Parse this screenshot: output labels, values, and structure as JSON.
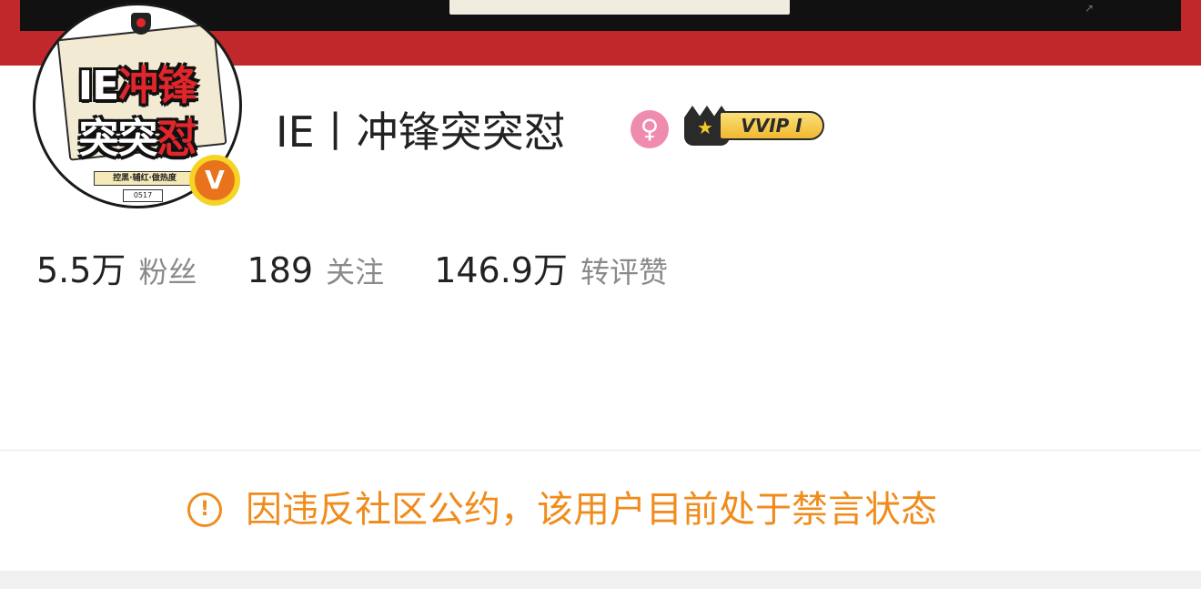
{
  "profile": {
    "avatar": {
      "line1a": "IE",
      "line1b": "冲锋",
      "line2a": "突突",
      "line2b": "怼",
      "tagline": "控黑·辅红·做热度",
      "code": "0517"
    },
    "verified_mark": "V",
    "username": "IE丨冲锋突突怼",
    "gender_icon": "female-icon",
    "vip_badge": "VVIP I"
  },
  "stats": [
    {
      "value": "5.5万",
      "label": "粉丝"
    },
    {
      "value": "189",
      "label": "关注"
    },
    {
      "value": "146.9万",
      "label": "转评赞"
    }
  ],
  "notice": {
    "icon": "!",
    "text": "因违反社区公约，该用户目前处于禁言状态"
  },
  "colors": {
    "banner": "#c0282b",
    "accent_orange": "#f08c1c",
    "text_primary": "#222222",
    "text_secondary": "#8a8a8a",
    "gender_pink": "#f08bb0"
  }
}
